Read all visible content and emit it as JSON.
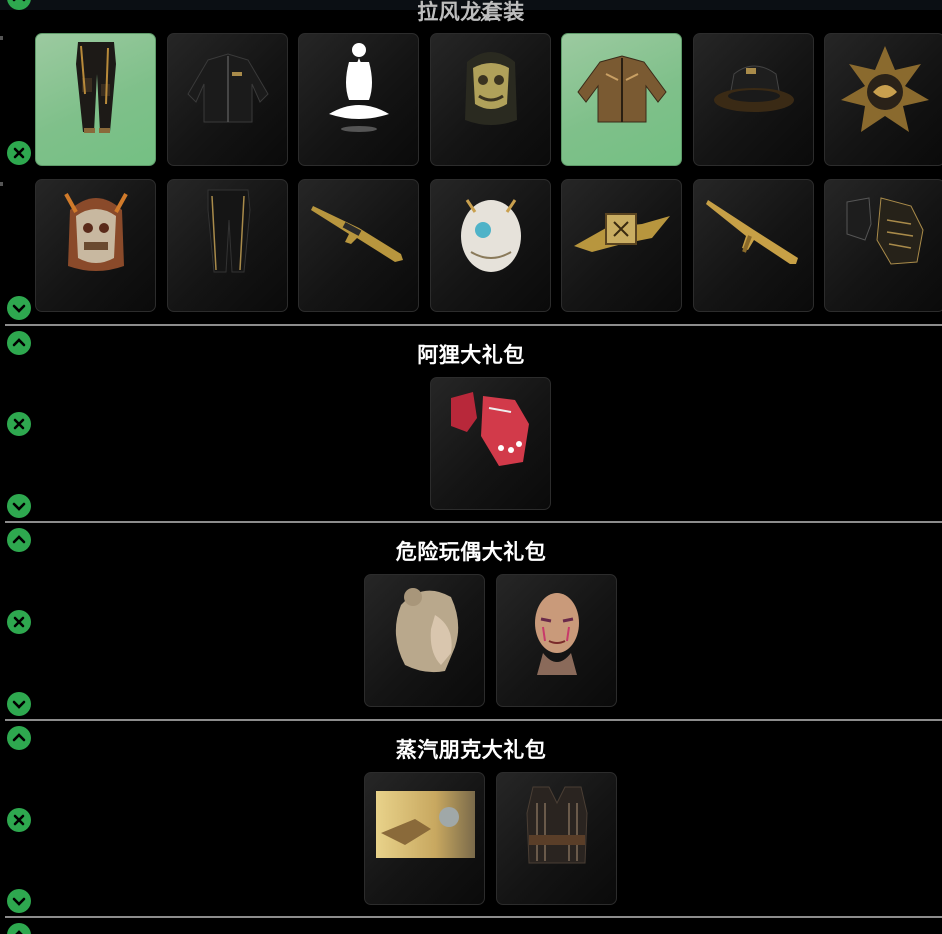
{
  "close_symbol": "×",
  "sections": [
    {
      "title": "拉风龙套装",
      "items": [
        {
          "name": "dragon-pants",
          "icon": "pants-icon"
        },
        {
          "name": "black-jacket",
          "icon": "jacket-icon"
        },
        {
          "name": "meditation-emote",
          "icon": "meditate-icon"
        },
        {
          "name": "gold-dragon-backpack",
          "icon": "backpack-icon"
        },
        {
          "name": "gold-leather-jacket",
          "icon": "jacket-icon"
        },
        {
          "name": "bucket-hat",
          "icon": "hat-icon"
        },
        {
          "name": "dragon-spray",
          "icon": "emblem-icon"
        },
        {
          "name": "dragon-face-backpack",
          "icon": "backpack-icon"
        },
        {
          "name": "black-track-pants",
          "icon": "pants-icon"
        },
        {
          "name": "gold-rifle",
          "icon": "rifle-icon"
        },
        {
          "name": "white-dragon-backpack",
          "icon": "backpack-icon"
        },
        {
          "name": "dragon-nameplate",
          "icon": "plate-icon"
        },
        {
          "name": "gold-ak-rifle",
          "icon": "rifle-icon"
        },
        {
          "name": "gold-gloves",
          "icon": "gloves-icon"
        }
      ]
    },
    {
      "title": "阿狸大礼包",
      "items": [
        {
          "name": "red-gloves",
          "icon": "gloves-icon"
        }
      ]
    },
    {
      "title": "危险玩偶大礼包",
      "items": [
        {
          "name": "blonde-hair",
          "icon": "hair-icon"
        },
        {
          "name": "face-paint",
          "icon": "face-icon"
        }
      ]
    },
    {
      "title": "蒸汽朋克大礼包",
      "items": [
        {
          "name": "steampunk-loading-screen",
          "icon": "image-icon"
        },
        {
          "name": "steampunk-vest",
          "icon": "vest-icon"
        }
      ]
    }
  ],
  "colors": {
    "control_green": "#2ea84f",
    "selected_card": "#7fc08a",
    "card_dark": "#141414",
    "divider": "#8c8c8c"
  }
}
